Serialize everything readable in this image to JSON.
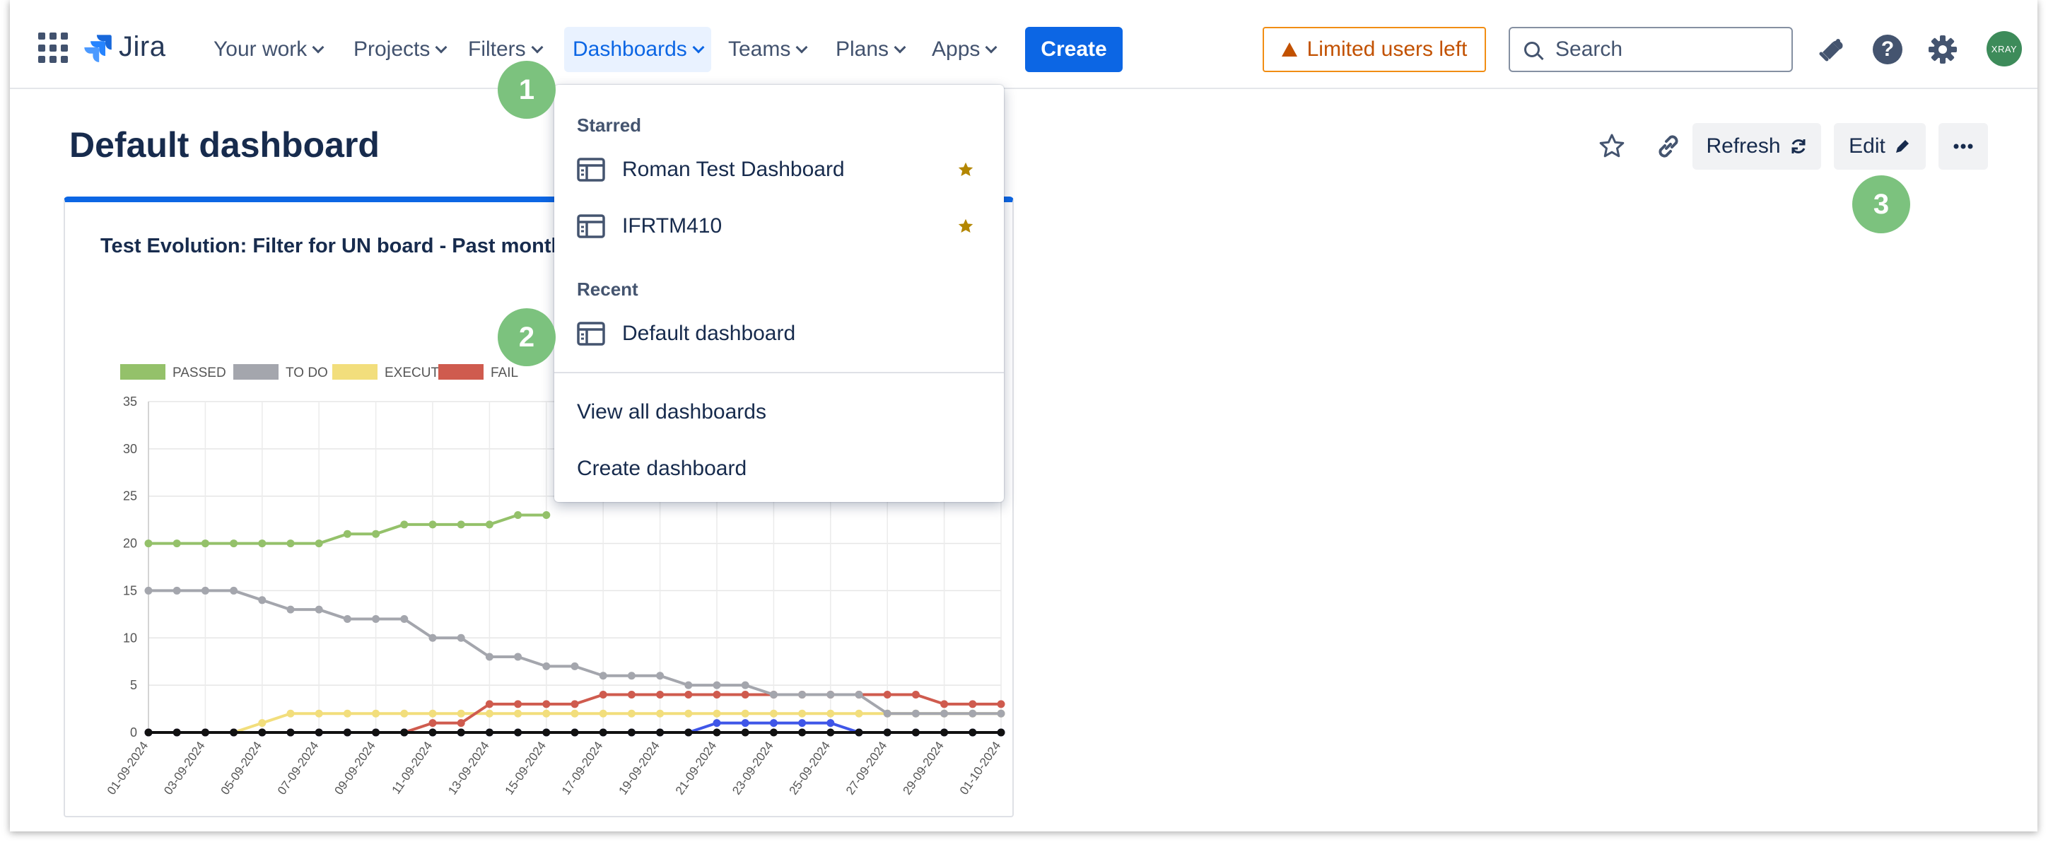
{
  "app": {
    "name": "Jira"
  },
  "nav": {
    "items": [
      {
        "label": "Your work"
      },
      {
        "label": "Projects"
      },
      {
        "label": "Filters"
      },
      {
        "label": "Dashboards"
      },
      {
        "label": "Teams"
      },
      {
        "label": "Plans"
      },
      {
        "label": "Apps"
      }
    ],
    "active": "Dashboards",
    "create_label": "Create",
    "limited_label": "Limited users left",
    "search_placeholder": "Search",
    "avatar_label": "XRAY"
  },
  "page": {
    "title": "Default dashboard",
    "refresh_label": "Refresh",
    "edit_label": "Edit"
  },
  "dropdown": {
    "starred_heading": "Starred",
    "starred": [
      {
        "label": "Roman Test Dashboard"
      },
      {
        "label": "IFRTM410"
      }
    ],
    "recent_heading": "Recent",
    "recent": [
      {
        "label": "Default dashboard"
      }
    ],
    "view_all_label": "View all dashboards",
    "create_label": "Create dashboard"
  },
  "badges": [
    "1",
    "2",
    "3"
  ],
  "gadget": {
    "title": "Test Evolution: Filter for UN board - Past month"
  },
  "colors": {
    "accent": "#0c66e4",
    "warning": "#c25100",
    "badge": "#7cc27e",
    "star": "#b38600"
  },
  "chart_data": {
    "type": "line",
    "legend": [
      "PASSED",
      "TO DO",
      "EXECUTING",
      "FAIL"
    ],
    "legend_placement": "top-left",
    "ylim": [
      0,
      35
    ],
    "yticks": [
      0,
      5,
      10,
      15,
      20,
      25,
      30,
      35
    ],
    "x": [
      "01-09-2024",
      "02-09-2024",
      "03-09-2024",
      "04-09-2024",
      "05-09-2024",
      "06-09-2024",
      "07-09-2024",
      "08-09-2024",
      "09-09-2024",
      "10-09-2024",
      "11-09-2024",
      "12-09-2024",
      "13-09-2024",
      "14-09-2024",
      "15-09-2024",
      "16-09-2024",
      "17-09-2024",
      "18-09-2024",
      "19-09-2024",
      "20-09-2024",
      "21-09-2024",
      "22-09-2024",
      "23-09-2024",
      "24-09-2024",
      "25-09-2024",
      "26-09-2024",
      "27-09-2024",
      "28-09-2024",
      "29-09-2024",
      "30-09-2024",
      "01-10-2024"
    ],
    "xtick_labels": [
      "01-09-2024",
      "03-09-2024",
      "05-09-2024",
      "07-09-2024",
      "09-09-2024",
      "11-09-2024",
      "13-09-2024",
      "15-09-2024",
      "17-09-2024",
      "19-09-2024",
      "21-09-2024",
      "23-09-2024",
      "25-09-2024",
      "27-09-2024",
      "29-09-2024",
      "01-10-2024"
    ],
    "grid": true,
    "series": [
      {
        "name": "PASSED",
        "color": "#94c16a",
        "values": [
          20,
          20,
          20,
          20,
          20,
          20,
          20,
          21,
          21,
          22,
          22,
          22,
          22,
          23,
          23,
          null,
          null,
          null,
          null,
          null,
          null,
          null,
          null,
          null,
          null,
          null,
          null,
          null,
          null,
          null,
          null
        ]
      },
      {
        "name": "TO DO",
        "color": "#a4a6ad",
        "values": [
          15,
          15,
          15,
          15,
          14,
          13,
          13,
          12,
          12,
          12,
          10,
          10,
          8,
          8,
          7,
          7,
          6,
          6,
          6,
          5,
          5,
          5,
          4,
          4,
          4,
          4,
          2,
          2,
          2,
          2,
          2
        ]
      },
      {
        "name": "EXECUTING",
        "color": "#f2de7c",
        "values": [
          0,
          0,
          0,
          0,
          1,
          2,
          2,
          2,
          2,
          2,
          2,
          2,
          2,
          2,
          2,
          2,
          2,
          2,
          2,
          2,
          2,
          2,
          2,
          2,
          2,
          2,
          2,
          2,
          2,
          2,
          2
        ]
      },
      {
        "name": "FAIL",
        "color": "#cf5b4e",
        "values": [
          0,
          0,
          0,
          0,
          0,
          0,
          0,
          0,
          0,
          0,
          1,
          1,
          3,
          3,
          3,
          3,
          4,
          4,
          4,
          4,
          4,
          4,
          4,
          4,
          4,
          4,
          4,
          4,
          3,
          3,
          3
        ]
      },
      {
        "name": "",
        "color": "#3f56e8",
        "values": [
          0,
          0,
          0,
          0,
          0,
          0,
          0,
          0,
          0,
          0,
          0,
          0,
          0,
          0,
          0,
          0,
          0,
          0,
          0,
          0,
          1,
          1,
          1,
          1,
          1,
          0,
          0,
          0,
          0,
          0,
          0
        ]
      },
      {
        "name": "",
        "color": "#111111",
        "values": [
          0,
          0,
          0,
          0,
          0,
          0,
          0,
          0,
          0,
          0,
          0,
          0,
          0,
          0,
          0,
          0,
          0,
          0,
          0,
          0,
          0,
          0,
          0,
          0,
          0,
          0,
          0,
          0,
          0,
          0,
          0
        ]
      }
    ]
  }
}
